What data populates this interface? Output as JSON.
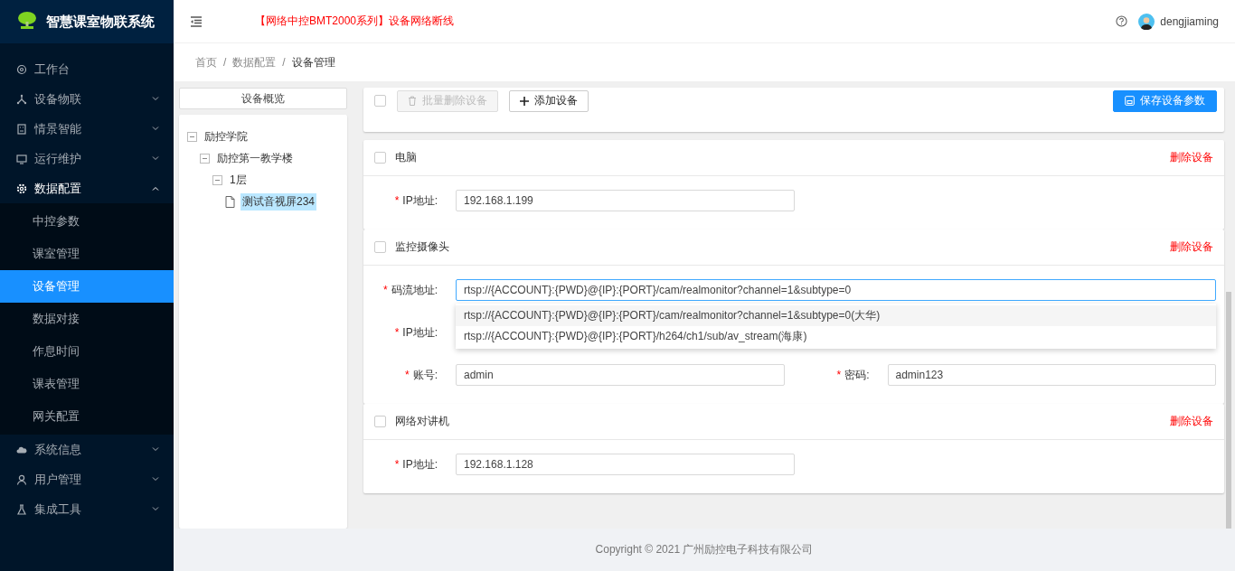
{
  "app": {
    "title": "智慧课室物联系统"
  },
  "sidebar": {
    "items": [
      {
        "label": "工作台"
      },
      {
        "label": "设备物联",
        "expanded": false
      },
      {
        "label": "情景智能",
        "expanded": false
      },
      {
        "label": "运行维护",
        "expanded": false
      },
      {
        "label": "数据配置",
        "expanded": true,
        "children": [
          {
            "label": "中控参数",
            "selected": false
          },
          {
            "label": "课室管理",
            "selected": false
          },
          {
            "label": "设备管理",
            "selected": true
          },
          {
            "label": "数据对接",
            "selected": false
          },
          {
            "label": "作息时间",
            "selected": false
          },
          {
            "label": "课表管理",
            "selected": false
          },
          {
            "label": "网关配置",
            "selected": false
          }
        ]
      },
      {
        "label": "系统信息",
        "expanded": false
      },
      {
        "label": "用户管理",
        "expanded": false
      },
      {
        "label": "集成工具",
        "expanded": false
      }
    ]
  },
  "header": {
    "alert": "【网络中控BMT2000系列】设备网络断线",
    "user": "dengjiaming"
  },
  "breadcrumb": [
    {
      "label": "首页",
      "separator": "/"
    },
    {
      "label": "数据配置",
      "separator": "/"
    },
    {
      "label": "设备管理"
    }
  ],
  "tree": {
    "title": "设备概览",
    "nodes": [
      {
        "label": "励控学院",
        "expanded": true,
        "children": [
          {
            "label": "励控第一教学楼",
            "expanded": true,
            "children": [
              {
                "label": "1层",
                "expanded": true,
                "children": [
                  {
                    "label": "测试音视屏234",
                    "selected": true
                  }
                ]
              }
            ]
          }
        ]
      }
    ]
  },
  "toolbar": {
    "select_all": {
      "checked": false
    },
    "batch_delete": {
      "label": "批量删除设备",
      "disabled": true
    },
    "add": {
      "label": "添加设备"
    },
    "save": {
      "label": "保存设备参数"
    }
  },
  "devices": [
    {
      "name": "电脑",
      "checked": false,
      "delete_label": "删除设备",
      "rows": [
        [
          {
            "label": "IP地址:",
            "required_mark": "*",
            "value": "192.168.1.199"
          }
        ]
      ]
    },
    {
      "name": "监控摄像头",
      "checked": false,
      "delete_label": "删除设备",
      "rows": [
        [
          {
            "label": "码流地址:",
            "required_mark": "*",
            "value": "rtsp://{ACCOUNT}:{PWD}@{IP}:{PORT}/cam/realmonitor?channel=1&subtype=0",
            "wide": true,
            "focused": true,
            "suggestions": [
              {
                "label": "rtsp://{ACCOUNT}:{PWD}@{IP}:{PORT}/cam/realmonitor?channel=1&subtype=0(大华)",
                "highlighted": true
              },
              {
                "label": "rtsp://{ACCOUNT}:{PWD}@{IP}:{PORT}/h264/ch1/sub/av_stream(海康)",
                "highlighted": false
              }
            ]
          }
        ],
        [
          {
            "label": "IP地址:",
            "required_mark": "*"
          }
        ],
        [
          {
            "label": "账号:",
            "required_mark": "*",
            "value": "admin"
          },
          {
            "label": "密码:",
            "required_mark": "*",
            "value": "admin123"
          }
        ]
      ]
    },
    {
      "name": "网络对讲机",
      "checked": false,
      "delete_label": "删除设备",
      "rows": [
        [
          {
            "label": "IP地址:",
            "required_mark": "*",
            "value": "192.168.1.128"
          }
        ]
      ]
    }
  ],
  "footer": {
    "copyright": "Copyright © 2021 广州励控电子科技有限公司"
  }
}
